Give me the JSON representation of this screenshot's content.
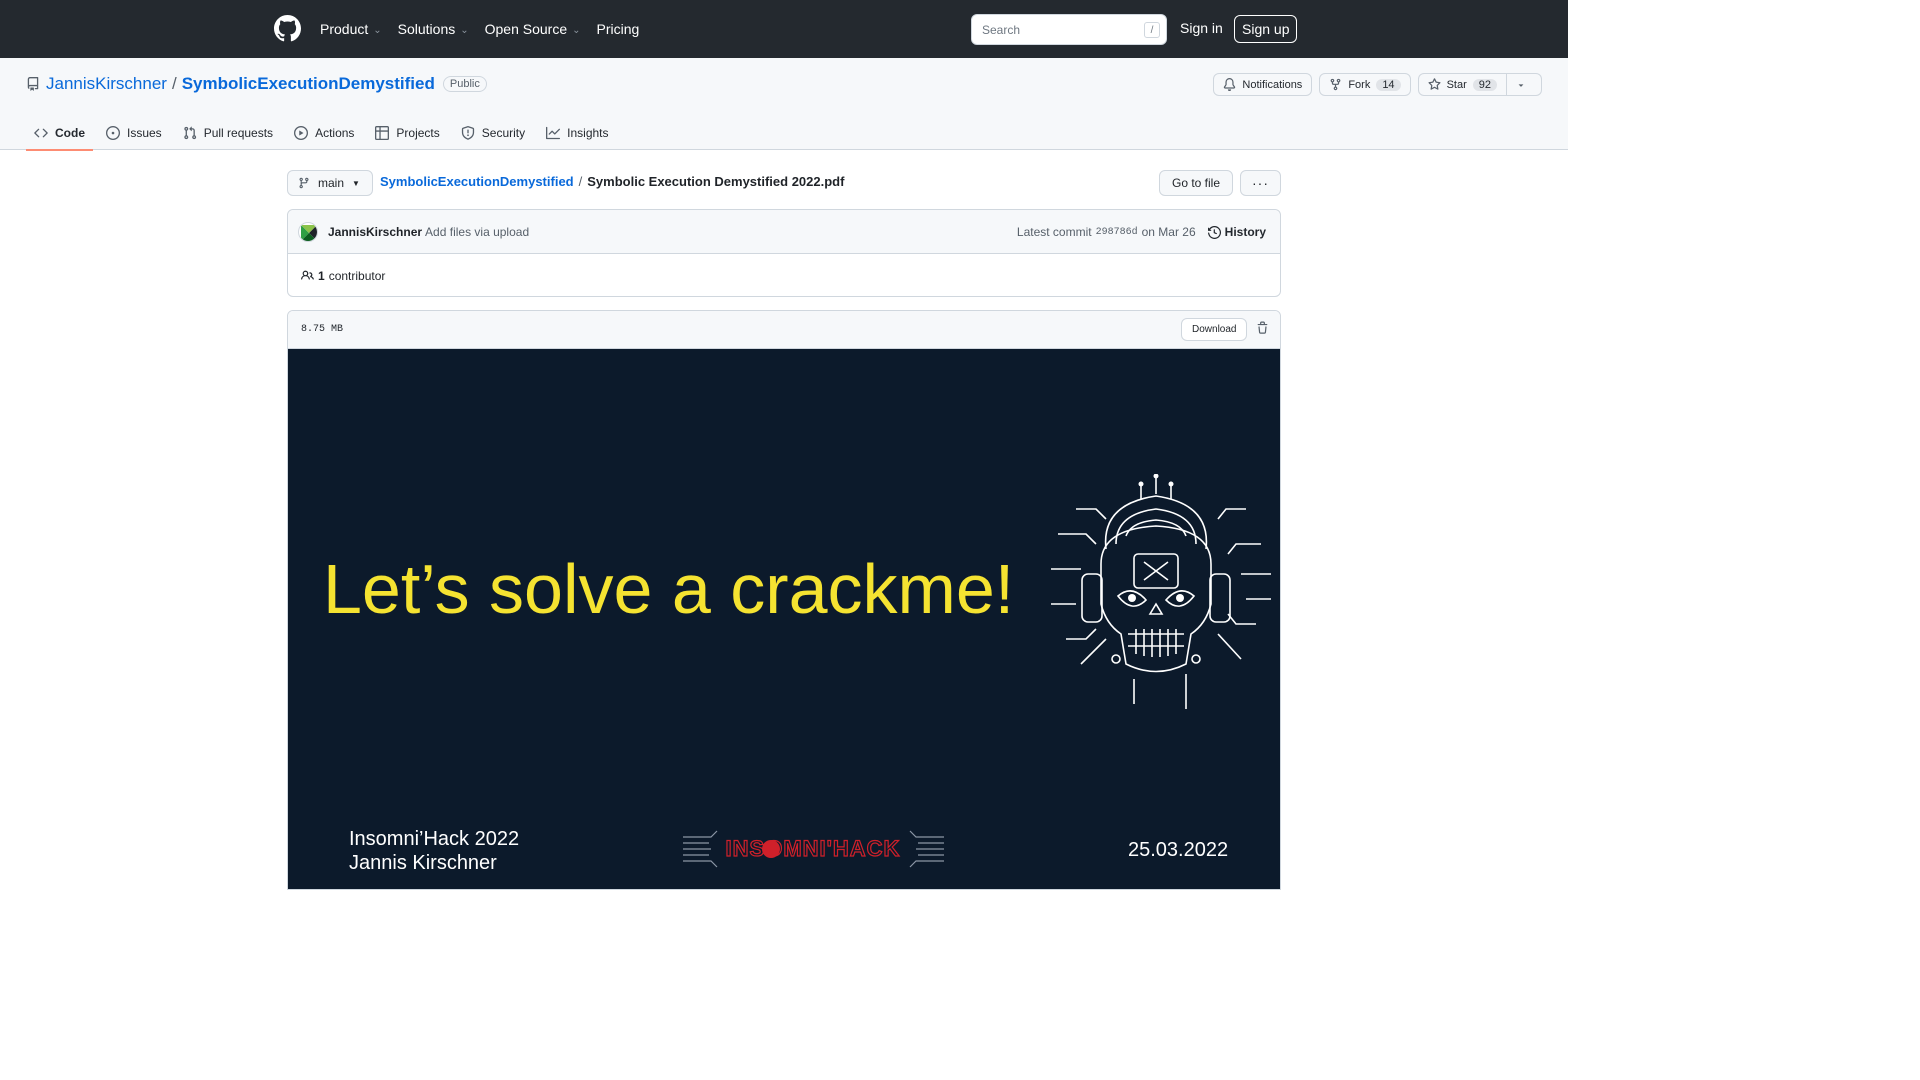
{
  "header": {
    "nav": [
      {
        "label": "Product",
        "dropdown": true
      },
      {
        "label": "Solutions",
        "dropdown": true
      },
      {
        "label": "Open Source",
        "dropdown": true
      },
      {
        "label": "Pricing",
        "dropdown": false
      }
    ],
    "search_placeholder": "Search",
    "search_shortcut": "/",
    "signin_label": "Sign in",
    "signup_label": "Sign up"
  },
  "repo": {
    "owner": "JannisKirschner",
    "separator": "/",
    "name": "SymbolicExecutionDemystified",
    "visibility": "Public",
    "notifications_label": "Notifications",
    "fork_label": "Fork",
    "fork_count": "14",
    "star_label": "Star",
    "star_count": "92"
  },
  "tabs": [
    {
      "label": "Code",
      "icon": "code-icon",
      "active": true
    },
    {
      "label": "Issues",
      "icon": "issue-icon",
      "active": false
    },
    {
      "label": "Pull requests",
      "icon": "pull-request-icon",
      "active": false
    },
    {
      "label": "Actions",
      "icon": "play-icon",
      "active": false
    },
    {
      "label": "Projects",
      "icon": "table-icon",
      "active": false
    },
    {
      "label": "Security",
      "icon": "shield-icon",
      "active": false
    },
    {
      "label": "Insights",
      "icon": "graph-icon",
      "active": false
    }
  ],
  "file_nav": {
    "branch": "main",
    "breadcrumb_repo": "SymbolicExecutionDemystified",
    "breadcrumb_sep": "/",
    "file_name": "Symbolic Execution Demystified 2022.pdf",
    "goto_label": "Go to file",
    "more_label": "···"
  },
  "commit": {
    "author": "JannisKirschner",
    "message": "Add files via upload",
    "latest_label": "Latest commit",
    "sha": "298786d",
    "date": "on Mar 26",
    "history_label": "History",
    "contributor_count": "1",
    "contributor_label": "contributor"
  },
  "file": {
    "size": "8.75 MB",
    "download_label": "Download"
  },
  "slide": {
    "title": "Let’s solve a crackme!",
    "event_line1": "Insomni’Hack 2022",
    "event_line2": "Jannis Kirschner",
    "date": "25.03.2022",
    "logo_text": "INSOMNI'HACK"
  },
  "colors": {
    "header_bg": "#24292f",
    "link": "#0969da",
    "tab_underline": "#fd8c73",
    "slide_bg": "#0c1a2b",
    "slide_title": "#f5e331",
    "logo_red": "#d0202a"
  }
}
